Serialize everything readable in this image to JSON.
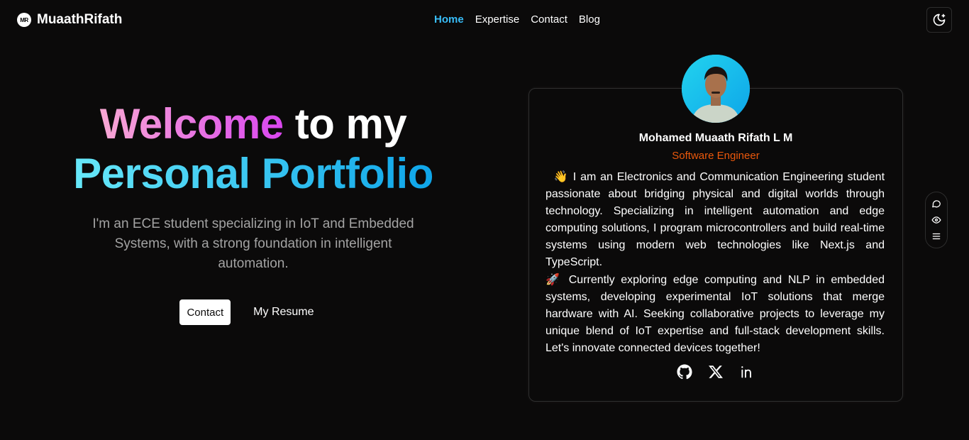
{
  "nav": {
    "logo_mark": "MR",
    "brand": "MuaathRifath",
    "links": [
      "Home",
      "Expertise",
      "Contact",
      "Blog"
    ]
  },
  "hero": {
    "title_part1": "Welcome",
    "title_part2": " to my",
    "title_line2": "Personal Portfolio",
    "subtitle": "I'm an ECE student specializing in IoT and Embedded Systems, with a strong foundation in intelligent automation.",
    "contact_label": "Contact",
    "resume_label": "My Resume"
  },
  "profile": {
    "name": "Mohamed Muaath Rifath L M",
    "role": "Software Engineer",
    "bio_emoji1": "👋",
    "bio_p1": " I am an Electronics and Communication Engineering student passionate about bridging physical and digital worlds through technology. Specializing in intelligent automation and edge computing solutions, I program microcontrollers and build real-time systems using modern web technologies like Next.js and TypeScript.",
    "bio_emoji2": "🚀",
    "bio_p2": " Currently exploring edge computing and NLP in embedded systems, developing experimental IoT solutions that merge hardware with AI. Seeking collaborative projects to leverage my unique blend of IoT expertise and full-stack development skills. Let's innovate connected devices together!"
  },
  "socials": [
    "github-icon",
    "x-icon",
    "linkedin-icon"
  ],
  "side_tools": [
    "chat-icon",
    "eye-icon",
    "menu-icon"
  ],
  "colors": {
    "background": "#0b0a0a",
    "accent_active": "#38bdf8",
    "role": "#ea580c",
    "welcome_gradient": [
      "#f9a8d4",
      "#d946ef"
    ],
    "portfolio_gradient": [
      "#67e8f9",
      "#0ea5e9"
    ]
  }
}
